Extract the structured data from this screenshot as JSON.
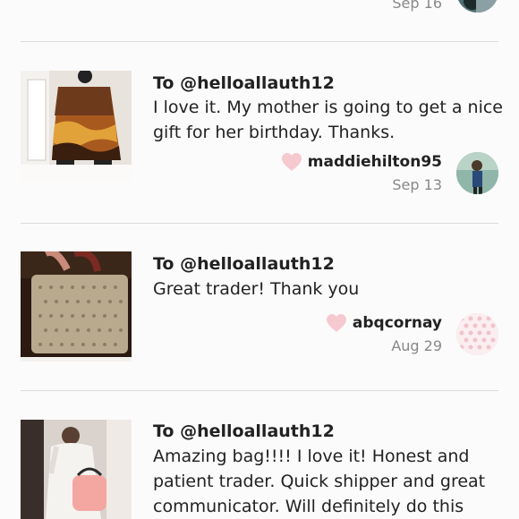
{
  "items": [
    {
      "date": "Sep 16"
    },
    {
      "to": "To @helloallauth12",
      "message": "I love it. My mother is going to get a nice gift for her birthday. Thanks.",
      "username": "maddiehilton95",
      "date": "Sep 13"
    },
    {
      "to": "To @helloallauth12",
      "message": "Great trader! Thank you",
      "username": "abqcornay",
      "date": "Aug 29"
    },
    {
      "to": "To @helloallauth12",
      "message": "Amazing bag!!!! I love it! Honest and patient trader. Quick shipper and great communicator. Will definitely do this"
    }
  ],
  "colors": {
    "heart": "#f6c9cf",
    "text": "#222222",
    "muted": "#888888",
    "divider": "#dcdcdc"
  }
}
